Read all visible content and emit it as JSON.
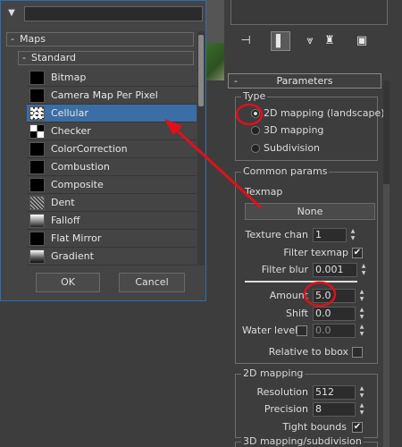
{
  "dialog": {
    "dropdown_icon": "triangle-down-icon",
    "search_value": "",
    "groups": {
      "maps": "Maps",
      "standard": "Standard"
    },
    "maps": [
      {
        "label": "Bitmap",
        "swatch": "black"
      },
      {
        "label": "Camera Map Per Pixel",
        "swatch": "black"
      },
      {
        "label": "Cellular",
        "swatch": "cellular",
        "selected": true
      },
      {
        "label": "Checker",
        "swatch": "checker"
      },
      {
        "label": "ColorCorrection",
        "swatch": "black"
      },
      {
        "label": "Combustion",
        "swatch": "black"
      },
      {
        "label": "Composite",
        "swatch": "black"
      },
      {
        "label": "Dent",
        "swatch": "dent"
      },
      {
        "label": "Falloff",
        "swatch": "falloff"
      },
      {
        "label": "Flat Mirror",
        "swatch": "black"
      },
      {
        "label": "Gradient",
        "swatch": "gradient"
      }
    ],
    "ok_label": "OK",
    "cancel_label": "Cancel"
  },
  "toolbar": {
    "icons": [
      "pin-stack-icon",
      "show-end-result-icon",
      "make-unique-icon",
      "remove-modifier-icon",
      "configure-modifier-sets-icon"
    ]
  },
  "parameters": {
    "title": "Parameters",
    "collapse_symbol": "-",
    "type_group": "Type",
    "type_options": [
      "2D mapping (landscape)",
      "3D mapping",
      "Subdivision"
    ],
    "type_selected": 0,
    "common_group": "Common params",
    "texmap_label": "Texmap",
    "texmap_button": "None",
    "texture_chan_label": "Texture chan",
    "texture_chan_value": "1",
    "filter_texmap_label": "Filter texmap",
    "filter_texmap_checked": true,
    "filter_blur_label": "Filter blur",
    "filter_blur_value": "0.001",
    "amount_label": "Amount",
    "amount_value": "5.0",
    "shift_label": "Shift",
    "shift_value": "0.0",
    "water_level_label": "Water level",
    "water_level_value": "0.0",
    "water_level_checked": false,
    "relative_bbox_label": "Relative to bbox",
    "relative_bbox_checked": false,
    "mapping2d_group": "2D mapping",
    "resolution_label": "Resolution",
    "resolution_value": "512",
    "precision_label": "Precision",
    "precision_value": "8",
    "tight_bounds_label": "Tight bounds",
    "tight_bounds_checked": true,
    "mapping3d_group": "3D mapping/subdivision"
  },
  "annotations": {
    "color": "#e0101a"
  }
}
